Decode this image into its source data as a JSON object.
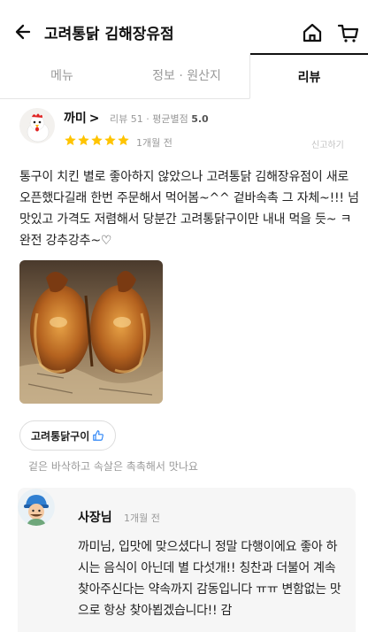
{
  "header": {
    "title": "고려통닭 김해장유점"
  },
  "tabs": [
    {
      "label": "메뉴",
      "active": false
    },
    {
      "label": "정보 · 원산지",
      "active": false
    },
    {
      "label": "리뷰",
      "active": true
    }
  ],
  "review": {
    "nickname": "까미",
    "review_count_label": "리뷰 51",
    "avg_rating_label": "평균별점",
    "avg_rating": "5.0",
    "rating": 5,
    "date": "1개월 전",
    "report_label": "신고하기",
    "text": "통구이 치킨 별로 좋아하지 않았으나 고려통닭 김해장유점이 새로 오픈했다길래 한번 주문해서 먹어봄~^^ 겉바속촉 그 자체~!!! 넘 맛있고 가격도 저렴해서 당분간 고려통닭구이만 내내 먹을 듯~ ㅋ 완전 강추강추~♡",
    "menu_tag": "고려통닭구이",
    "menu_tag_note": "겉은 바삭하고 속살은 촉촉해서 맛나요"
  },
  "owner_reply": {
    "name": "사장님",
    "date": "1개월 전",
    "text": "까미님, 입맛에 맞으셨다니 정말 다행이에요 좋아 하시는 음식이 아닌데 별 다섯개!! 칭찬과 더불어 계속 찾아주신다는 약속까지 감동입니다 ㅠㅠ 변함없는 맛으로 항상 찾아뵙겠습니다!! 감"
  },
  "colors": {
    "star": "#ffc400",
    "thumb": "#2f86f6",
    "text": "#222222",
    "muted": "#999999"
  },
  "icons": [
    "back-arrow-icon",
    "home-icon",
    "cart-icon",
    "chevron-right-icon",
    "star-icon",
    "thumbs-up-icon"
  ]
}
